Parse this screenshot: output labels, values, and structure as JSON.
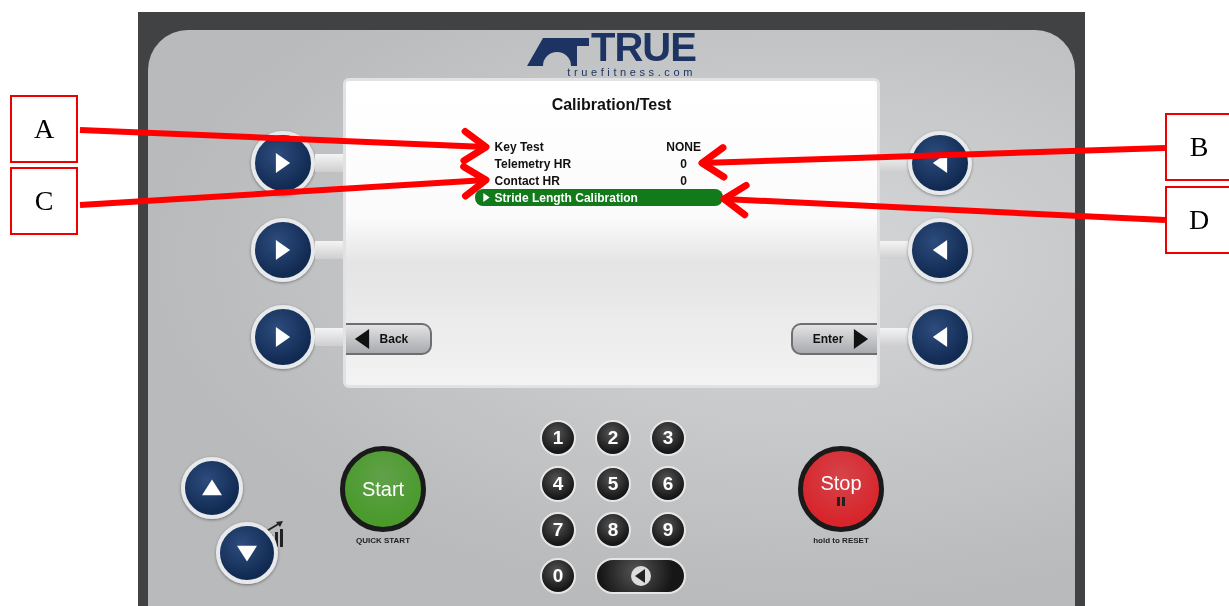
{
  "brand": {
    "name": "TRUE",
    "website": "truefitness.com"
  },
  "screen": {
    "title": "Calibration/Test",
    "rows": [
      {
        "kind": "value",
        "label": "Key Test",
        "value": "NONE",
        "selected": false
      },
      {
        "kind": "value",
        "label": "Telemetry HR",
        "value": "0",
        "selected": false
      },
      {
        "kind": "value",
        "label": "Contact HR",
        "value": "0",
        "selected": false
      },
      {
        "kind": "action",
        "label": "Stride Length Calibration",
        "selected": true
      }
    ],
    "back_button": "Back",
    "enter_button": "Enter"
  },
  "start_button": {
    "label": "Start",
    "caption": "QUICK START"
  },
  "keypad": {
    "keys": [
      "1",
      "2",
      "3",
      "4",
      "5",
      "6",
      "7",
      "8",
      "9",
      "0"
    ]
  },
  "stop_button": {
    "label": "Stop",
    "caption": "hold to RESET"
  },
  "annotations": [
    {
      "label": "A"
    },
    {
      "label": "B"
    },
    {
      "label": "C"
    },
    {
      "label": "D"
    }
  ]
}
